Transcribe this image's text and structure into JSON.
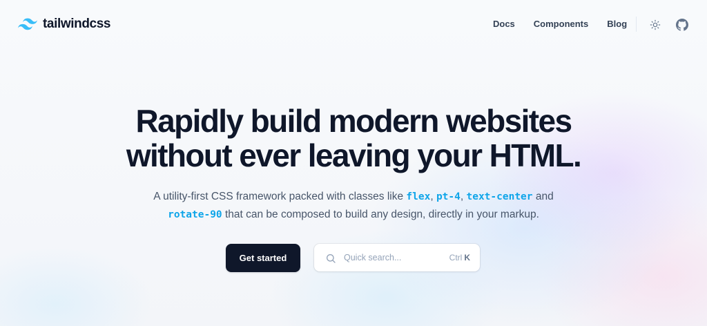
{
  "brand": {
    "name": "tailwindcss"
  },
  "nav": {
    "items": [
      {
        "label": "Docs"
      },
      {
        "label": "Components"
      },
      {
        "label": "Blog"
      }
    ],
    "theme_toggle_icon": "sun-icon",
    "github_icon": "github-icon"
  },
  "hero": {
    "headline_line1": "Rapidly build modern websites",
    "headline_line2": "without ever leaving your HTML.",
    "subtitle": {
      "part1": "A utility-first CSS framework packed with classes like ",
      "code1": "flex",
      "sep1": ", ",
      "code2": "pt-4",
      "sep2": ", ",
      "code3": "text-center",
      "part2": " and",
      "code4": "rotate-90",
      "part3": " that can be composed to build any design, directly in your markup."
    },
    "cta_label": "Get started",
    "search": {
      "placeholder": "Quick search...",
      "shortcut_modifier": "Ctrl",
      "shortcut_key": "K"
    }
  },
  "colors": {
    "brand_accent": "#38bdf8",
    "code_color": "#0ea5e9",
    "heading": "#0f172a",
    "button_bg": "#0f172a"
  }
}
